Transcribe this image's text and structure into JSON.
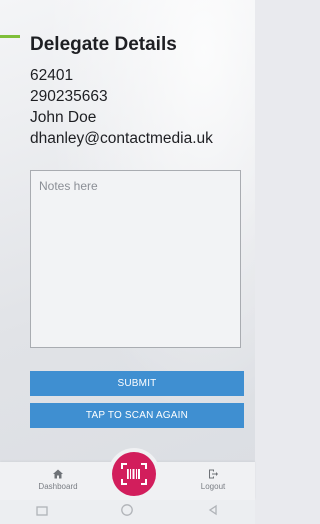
{
  "header": {
    "title": "Delegate Details"
  },
  "delegate": {
    "id": "62401",
    "phone": "290235663",
    "name": "John Doe",
    "email": "dhanley@contactmedia.uk"
  },
  "notes": {
    "placeholder": "Notes here"
  },
  "actions": {
    "submit_label": "SUBMIT",
    "scan_again_label": "TAP TO SCAN AGAIN"
  },
  "bottom_nav": {
    "dashboard_label": "Dashboard",
    "logout_label": "Logout",
    "scan_icon": "barcode-scan-icon"
  },
  "colors": {
    "accent_blue": "#3f8fd1",
    "scan_pink": "#d21e5c",
    "green_accent": "#7fbf3a"
  }
}
